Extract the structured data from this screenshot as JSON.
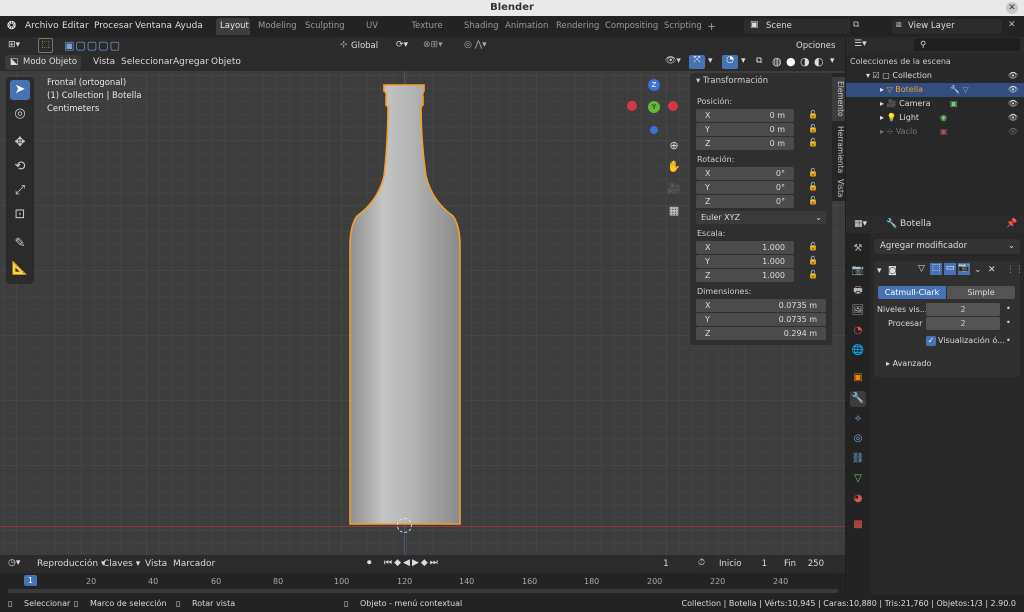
{
  "window": {
    "title": "Blender"
  },
  "menubar": {
    "items": [
      "Archivo",
      "Editar",
      "Procesar",
      "Ventana",
      "Ayuda"
    ]
  },
  "workspaces": [
    "Layout",
    "Modeling",
    "Sculpting",
    "UV Editing",
    "Texture Paint",
    "Shading",
    "Animation",
    "Rendering",
    "Compositing",
    "Scripting"
  ],
  "workspace_add": "+",
  "scene": "Scene",
  "view_layer": "View Layer",
  "header": {
    "orientation": "Global",
    "options": "Opciones"
  },
  "viewport_menu": {
    "mode": "Modo Objeto",
    "items": [
      "Vista",
      "Seleccionar",
      "Agregar",
      "Objeto"
    ]
  },
  "viewport_info": {
    "view": "Frontal (ortogonal)",
    "collection": "(1) Collection | Botella",
    "units": "Centimeters"
  },
  "gizmo": {
    "z": "Z",
    "y": "Y"
  },
  "npanel": {
    "title": "Transformación",
    "position_label": "Posición:",
    "position": [
      {
        "k": "X",
        "v": "0 m"
      },
      {
        "k": "Y",
        "v": "0 m"
      },
      {
        "k": "Z",
        "v": "0 m"
      }
    ],
    "rotation_label": "Rotación:",
    "rotation": [
      {
        "k": "X",
        "v": "0°"
      },
      {
        "k": "Y",
        "v": "0°"
      },
      {
        "k": "Z",
        "v": "0°"
      }
    ],
    "rotation_mode": "Euler XYZ",
    "scale_label": "Escala:",
    "scale": [
      {
        "k": "X",
        "v": "1.000"
      },
      {
        "k": "Y",
        "v": "1.000"
      },
      {
        "k": "Z",
        "v": "1.000"
      }
    ],
    "dimensions_label": "Dimensiones:",
    "dimensions": [
      {
        "k": "X",
        "v": "0.0735 m"
      },
      {
        "k": "Y",
        "v": "0.0735 m"
      },
      {
        "k": "Z",
        "v": "0.294 m"
      }
    ],
    "tabs": [
      "Elemento",
      "Herramienta",
      "Vista"
    ]
  },
  "outliner": {
    "title": "Colecciones de la escena",
    "items": [
      {
        "label": "Collection"
      },
      {
        "label": "Botella"
      },
      {
        "label": "Camera"
      },
      {
        "label": "Light"
      },
      {
        "label": "Vacío"
      }
    ]
  },
  "properties": {
    "object": "Botella",
    "add_modifier": "Agregar modificador",
    "subdiv_tabs": [
      "Catmull-Clark",
      "Simple"
    ],
    "levels_label": "Niveles vis...",
    "levels_value": "2",
    "render_label": "Procesar",
    "render_value": "2",
    "optimal_label": "Visualización ó...",
    "advanced": "Avanzado"
  },
  "timeline": {
    "menu": [
      "Reproducción",
      "Claves",
      "Vista",
      "Marcador"
    ],
    "current_frame": "1",
    "start_label": "Inicio",
    "start": "1",
    "end_label": "Fin",
    "end": "250",
    "ruler": [
      "1",
      "20",
      "40",
      "60",
      "80",
      "100",
      "120",
      "140",
      "160",
      "180",
      "200",
      "220",
      "240"
    ]
  },
  "statusbar": {
    "select": "Seleccionar",
    "box": "Marco de selección",
    "rotate": "Rotar vista",
    "context": "Objeto - menú contextual",
    "stats": "Collection | Botella | Vérts:10,945 | Caras:10,880 | Tris:21,760 | Objetos:1/3 | 2.90.0"
  },
  "colors": {
    "accent": "#4772b3",
    "selection_outline": "#f0a030",
    "grid_x_axis": "#8a3a3a"
  }
}
